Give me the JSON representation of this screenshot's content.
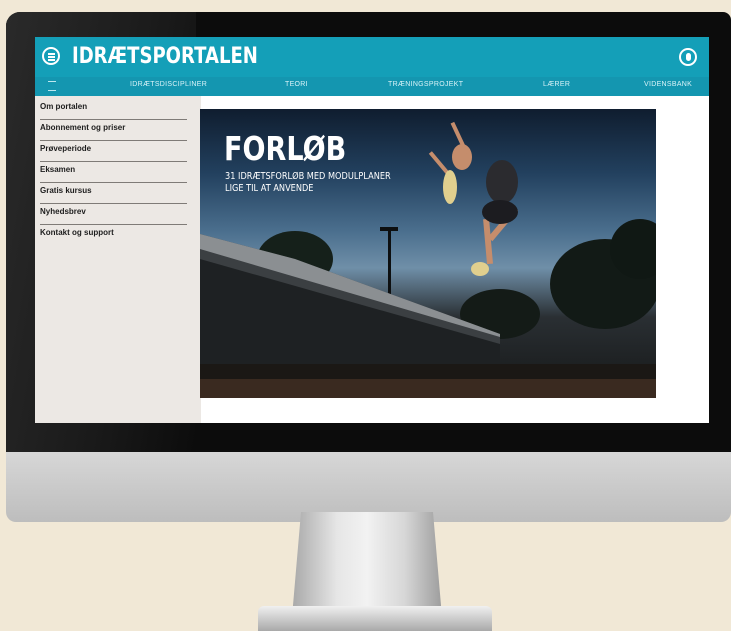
{
  "header": {
    "brand": "IDRÆTSPORTALEN"
  },
  "nav": {
    "items": [
      {
        "label": "IDRÆTSDISCIPLINER"
      },
      {
        "label": "TEORI"
      },
      {
        "label": "TRÆNINGSPROJEKT"
      },
      {
        "label": "LÆRER"
      },
      {
        "label": "VIDENSBANK"
      }
    ]
  },
  "sidebar": {
    "items": [
      {
        "label": "Om portalen"
      },
      {
        "label": "Abonnement og priser"
      },
      {
        "label": "Prøveperiode"
      },
      {
        "label": "Eksamen"
      },
      {
        "label": "Gratis kursus"
      },
      {
        "label": "Nyhedsbrev"
      },
      {
        "label": "Kontakt og support"
      }
    ]
  },
  "hero": {
    "title": "FORLØB",
    "subtitle": "31 IDRÆTSFORLØB MED MODULPLANER\nLIGE TIL AT ANVENDE"
  },
  "colors": {
    "accent": "#149fb8",
    "nav": "#1496b0",
    "sidebar": "#ece8e4",
    "background": "#f1e8d6"
  },
  "icons": {
    "menu": "menu-icon",
    "user": "user-icon",
    "home": "home-icon"
  }
}
